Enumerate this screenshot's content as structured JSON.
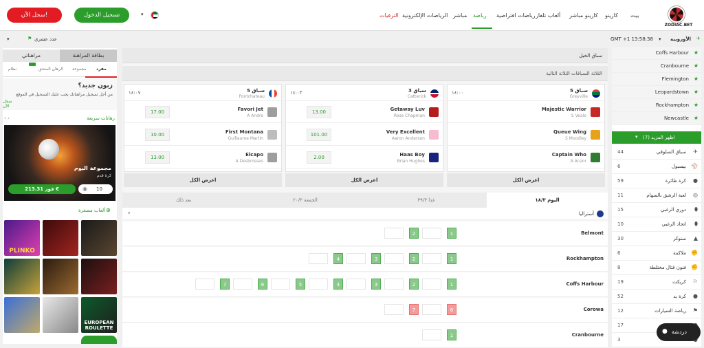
{
  "brand": {
    "name": "ZODIAC.BET"
  },
  "nav": {
    "items": [
      "بيت",
      "كازينو",
      "كازينو مباشر",
      "ألعاب تلفاز",
      "رياضات افتراضية",
      "رياضة",
      "مباشر",
      "الرياضات الإلكترونية",
      "الترقيات"
    ],
    "active": "رياضة",
    "promo": "الترقيات"
  },
  "header": {
    "login": "تسجيل الدخول",
    "register": "سجل الآن!",
    "currency_symbol": "▾"
  },
  "subbar": {
    "region": "الأوروبية",
    "time": "GMT +1 13:58:38",
    "odds_format": "عدد عشري"
  },
  "right_sidebar": {
    "favorites": [
      "Coffs Harbour",
      "Cranbourne",
      "Flemington",
      "Leopardstown",
      "Rockhampton",
      "Newcastle"
    ],
    "more_label": "اظهر المزيد (7)",
    "sports": [
      {
        "name": "سباق السلوقي",
        "count": "44",
        "icon": "✈"
      },
      {
        "name": "بيسبول",
        "count": "6",
        "icon": "⚾"
      },
      {
        "name": "كرة طائرة",
        "count": "59",
        "icon": "●"
      },
      {
        "name": "لعبة الرشق بالسهام",
        "count": "11",
        "icon": "◎"
      },
      {
        "name": "دوري الرغبي",
        "count": "15",
        "icon": "⬮"
      },
      {
        "name": "اتحاد الرغبي",
        "count": "10",
        "icon": "⬮"
      },
      {
        "name": "سنوكر",
        "count": "30",
        "icon": "▲"
      },
      {
        "name": "ملاكمة",
        "count": "6",
        "icon": "✊"
      },
      {
        "name": "فنون قتال مختلطة",
        "count": "8",
        "icon": "✊"
      },
      {
        "name": "كريكت",
        "count": "19",
        "icon": "⚐"
      },
      {
        "name": "كرة يد",
        "count": "52",
        "icon": "●"
      },
      {
        "name": "رياضة السيارات",
        "count": "12",
        "icon": "⚑"
      },
      {
        "name": "",
        "count": "17",
        "icon": "●"
      },
      {
        "name": "",
        "count": "3",
        "icon": "●"
      }
    ]
  },
  "center": {
    "section_title": "سباق الخيل",
    "next_races_title": "الثلاثة السباقات الثلاثة التالية",
    "races": [
      {
        "race": "سباق 5",
        "venue": "Greyville",
        "time": "١٤:٠٠",
        "flag": "ZA",
        "runners": [
          {
            "name": "Majestic Warrior",
            "jockey": "S Veale",
            "odds": ""
          },
          {
            "name": "Queue Wing",
            "jockey": "S Moodley",
            "odds": ""
          },
          {
            "name": "Captain Who",
            "jockey": "A Anzor",
            "odds": ""
          }
        ]
      },
      {
        "race": "سباق 3",
        "venue": "Catterick",
        "time": "١٤:٠٣",
        "flag": "GB",
        "runners": [
          {
            "name": "Getaway Luv",
            "jockey": "Rose Chapman",
            "odds": "13.00"
          },
          {
            "name": "Very Excellent",
            "jockey": "Aaron Anderson",
            "odds": "101.00"
          },
          {
            "name": "Haas Boy",
            "jockey": "Brian Hughes",
            "odds": "2.00"
          }
        ]
      },
      {
        "race": "سباق 5",
        "venue": "Pontchateau",
        "time": "١٤:٠٧",
        "flag": "FR",
        "runners": [
          {
            "name": "Favori Jet",
            "jockey": "A Andre",
            "odds": "17.00"
          },
          {
            "name": "First Montana",
            "jockey": "Guillaume Martin",
            "odds": "10.00"
          },
          {
            "name": "Elcapo",
            "jockey": "A Desbrosses",
            "odds": "13.00"
          }
        ]
      }
    ],
    "show_all": "اعرض الكل",
    "day_tabs": [
      "اليوم ١٨/٣",
      "غدا ٣٩/٣",
      "الجمعة ٢٠/٣",
      "بعد ذلك"
    ],
    "region_label": "أستراليا",
    "meetings": [
      {
        "name": "Belmont",
        "boxes": [
          {
            "n": "1",
            "c": "g"
          },
          {
            "n": "2",
            "c": "g"
          }
        ]
      },
      {
        "name": "Rockhampton",
        "boxes": [
          {
            "n": "1",
            "c": "g"
          },
          {
            "n": "2",
            "c": "g"
          },
          {
            "n": "3",
            "c": "g"
          },
          {
            "n": "4",
            "c": "g"
          }
        ]
      },
      {
        "name": "Coffs Harbour",
        "boxes": [
          {
            "n": "1",
            "c": "g"
          },
          {
            "n": "2",
            "c": "g"
          },
          {
            "n": "3",
            "c": "g"
          },
          {
            "n": "4",
            "c": "g"
          },
          {
            "n": "5",
            "c": "g"
          },
          {
            "n": "6",
            "c": "g"
          },
          {
            "n": "7",
            "c": "g"
          }
        ]
      },
      {
        "name": "Corowa",
        "boxes": [
          {
            "n": "6",
            "c": "r"
          },
          {
            "n": "7",
            "c": "r"
          }
        ]
      },
      {
        "name": "Cranbourne",
        "boxes": [
          {
            "n": "1",
            "c": "g"
          }
        ]
      }
    ]
  },
  "left_sidebar": {
    "tabs": [
      "بطاقة المراهنة",
      "مراهناتي"
    ],
    "subtabs": [
      "مفرد",
      "مجموعة",
      "الرهان المتحق",
      "نظام"
    ],
    "new_title": "زبون جديد؟",
    "new_text": "من أجل تسجيل مراهناتك يجب عليك التسجيل في الموقع",
    "new_link": "سجل الآن",
    "quick_title": "رهانات سريعة",
    "promo_title": "مجموعة اليوم",
    "promo_sub": "كرة قدم",
    "stake": "10",
    "win_btn": "فوز 213.31 €",
    "mini_games_title": "ألعاب مصغرة",
    "games": [
      "PLINKO",
      "",
      "",
      "",
      "",
      "",
      "",
      "",
      "EUROPEAN ROULETTE"
    ]
  },
  "chat": {
    "label": "دردشة"
  }
}
